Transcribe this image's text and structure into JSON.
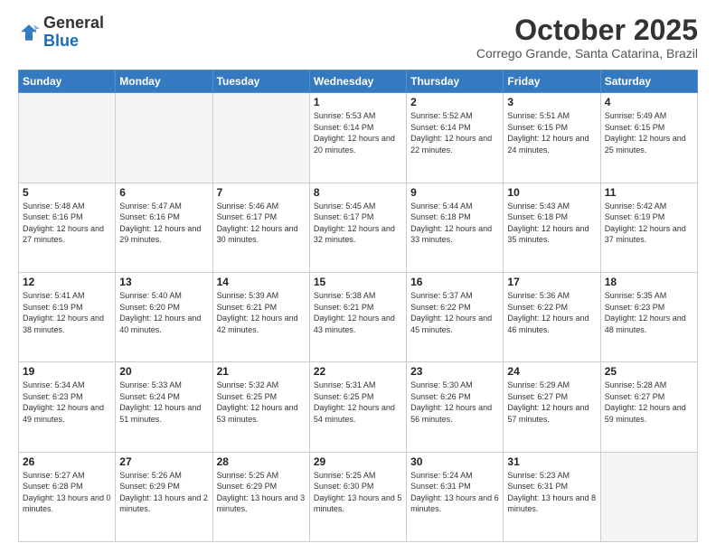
{
  "header": {
    "logo_general": "General",
    "logo_blue": "Blue",
    "month_title": "October 2025",
    "location": "Corrego Grande, Santa Catarina, Brazil"
  },
  "weekdays": [
    "Sunday",
    "Monday",
    "Tuesday",
    "Wednesday",
    "Thursday",
    "Friday",
    "Saturday"
  ],
  "weeks": [
    [
      {
        "day": "",
        "empty": true
      },
      {
        "day": "",
        "empty": true
      },
      {
        "day": "",
        "empty": true
      },
      {
        "day": "1",
        "sunrise": "5:53 AM",
        "sunset": "6:14 PM",
        "daylight": "12 hours and 20 minutes."
      },
      {
        "day": "2",
        "sunrise": "5:52 AM",
        "sunset": "6:14 PM",
        "daylight": "12 hours and 22 minutes."
      },
      {
        "day": "3",
        "sunrise": "5:51 AM",
        "sunset": "6:15 PM",
        "daylight": "12 hours and 24 minutes."
      },
      {
        "day": "4",
        "sunrise": "5:49 AM",
        "sunset": "6:15 PM",
        "daylight": "12 hours and 25 minutes."
      }
    ],
    [
      {
        "day": "5",
        "sunrise": "5:48 AM",
        "sunset": "6:16 PM",
        "daylight": "12 hours and 27 minutes."
      },
      {
        "day": "6",
        "sunrise": "5:47 AM",
        "sunset": "6:16 PM",
        "daylight": "12 hours and 29 minutes."
      },
      {
        "day": "7",
        "sunrise": "5:46 AM",
        "sunset": "6:17 PM",
        "daylight": "12 hours and 30 minutes."
      },
      {
        "day": "8",
        "sunrise": "5:45 AM",
        "sunset": "6:17 PM",
        "daylight": "12 hours and 32 minutes."
      },
      {
        "day": "9",
        "sunrise": "5:44 AM",
        "sunset": "6:18 PM",
        "daylight": "12 hours and 33 minutes."
      },
      {
        "day": "10",
        "sunrise": "5:43 AM",
        "sunset": "6:18 PM",
        "daylight": "12 hours and 35 minutes."
      },
      {
        "day": "11",
        "sunrise": "5:42 AM",
        "sunset": "6:19 PM",
        "daylight": "12 hours and 37 minutes."
      }
    ],
    [
      {
        "day": "12",
        "sunrise": "5:41 AM",
        "sunset": "6:19 PM",
        "daylight": "12 hours and 38 minutes."
      },
      {
        "day": "13",
        "sunrise": "5:40 AM",
        "sunset": "6:20 PM",
        "daylight": "12 hours and 40 minutes."
      },
      {
        "day": "14",
        "sunrise": "5:39 AM",
        "sunset": "6:21 PM",
        "daylight": "12 hours and 42 minutes."
      },
      {
        "day": "15",
        "sunrise": "5:38 AM",
        "sunset": "6:21 PM",
        "daylight": "12 hours and 43 minutes."
      },
      {
        "day": "16",
        "sunrise": "5:37 AM",
        "sunset": "6:22 PM",
        "daylight": "12 hours and 45 minutes."
      },
      {
        "day": "17",
        "sunrise": "5:36 AM",
        "sunset": "6:22 PM",
        "daylight": "12 hours and 46 minutes."
      },
      {
        "day": "18",
        "sunrise": "5:35 AM",
        "sunset": "6:23 PM",
        "daylight": "12 hours and 48 minutes."
      }
    ],
    [
      {
        "day": "19",
        "sunrise": "5:34 AM",
        "sunset": "6:23 PM",
        "daylight": "12 hours and 49 minutes."
      },
      {
        "day": "20",
        "sunrise": "5:33 AM",
        "sunset": "6:24 PM",
        "daylight": "12 hours and 51 minutes."
      },
      {
        "day": "21",
        "sunrise": "5:32 AM",
        "sunset": "6:25 PM",
        "daylight": "12 hours and 53 minutes."
      },
      {
        "day": "22",
        "sunrise": "5:31 AM",
        "sunset": "6:25 PM",
        "daylight": "12 hours and 54 minutes."
      },
      {
        "day": "23",
        "sunrise": "5:30 AM",
        "sunset": "6:26 PM",
        "daylight": "12 hours and 56 minutes."
      },
      {
        "day": "24",
        "sunrise": "5:29 AM",
        "sunset": "6:27 PM",
        "daylight": "12 hours and 57 minutes."
      },
      {
        "day": "25",
        "sunrise": "5:28 AM",
        "sunset": "6:27 PM",
        "daylight": "12 hours and 59 minutes."
      }
    ],
    [
      {
        "day": "26",
        "sunrise": "5:27 AM",
        "sunset": "6:28 PM",
        "daylight": "13 hours and 0 minutes."
      },
      {
        "day": "27",
        "sunrise": "5:26 AM",
        "sunset": "6:29 PM",
        "daylight": "13 hours and 2 minutes."
      },
      {
        "day": "28",
        "sunrise": "5:25 AM",
        "sunset": "6:29 PM",
        "daylight": "13 hours and 3 minutes."
      },
      {
        "day": "29",
        "sunrise": "5:25 AM",
        "sunset": "6:30 PM",
        "daylight": "13 hours and 5 minutes."
      },
      {
        "day": "30",
        "sunrise": "5:24 AM",
        "sunset": "6:31 PM",
        "daylight": "13 hours and 6 minutes."
      },
      {
        "day": "31",
        "sunrise": "5:23 AM",
        "sunset": "6:31 PM",
        "daylight": "13 hours and 8 minutes."
      },
      {
        "day": "",
        "empty": true
      }
    ]
  ],
  "labels": {
    "sunrise_prefix": "Sunrise: ",
    "sunset_prefix": "Sunset: ",
    "daylight_prefix": "Daylight: "
  }
}
